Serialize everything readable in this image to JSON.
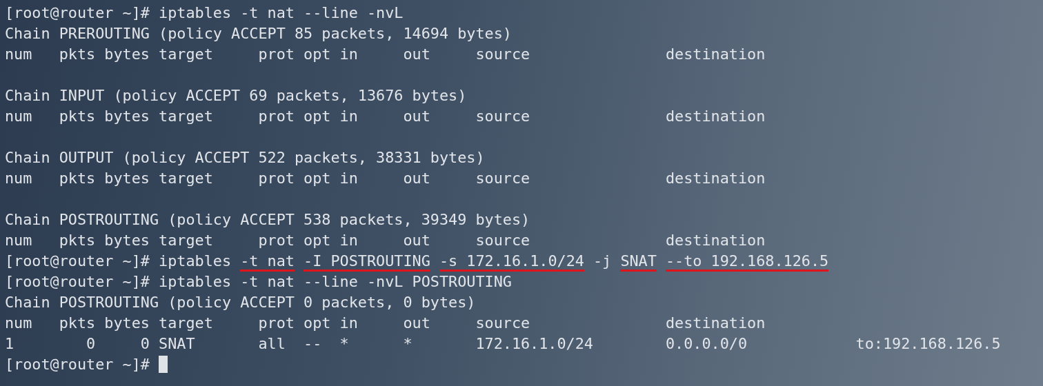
{
  "terminal": {
    "lines": [
      {
        "kind": "text",
        "segments": [
          {
            "text": "[root@router ~]# iptables -t nat --line -nvL",
            "underlined": false
          }
        ]
      },
      {
        "kind": "text",
        "segments": [
          {
            "text": "Chain PREROUTING (policy ACCEPT 85 packets, 14694 bytes)",
            "underlined": false
          }
        ]
      },
      {
        "kind": "text",
        "segments": [
          {
            "text": "num   pkts bytes target     prot opt in     out     source               destination",
            "underlined": false
          }
        ]
      },
      {
        "kind": "blank"
      },
      {
        "kind": "text",
        "segments": [
          {
            "text": "Chain INPUT (policy ACCEPT 69 packets, 13676 bytes)",
            "underlined": false
          }
        ]
      },
      {
        "kind": "text",
        "segments": [
          {
            "text": "num   pkts bytes target     prot opt in     out     source               destination",
            "underlined": false
          }
        ]
      },
      {
        "kind": "blank"
      },
      {
        "kind": "text",
        "segments": [
          {
            "text": "Chain OUTPUT (policy ACCEPT 522 packets, 38331 bytes)",
            "underlined": false
          }
        ]
      },
      {
        "kind": "text",
        "segments": [
          {
            "text": "num   pkts bytes target     prot opt in     out     source               destination",
            "underlined": false
          }
        ]
      },
      {
        "kind": "blank"
      },
      {
        "kind": "text",
        "segments": [
          {
            "text": "Chain POSTROUTING (policy ACCEPT 538 packets, 39349 bytes)",
            "underlined": false
          }
        ]
      },
      {
        "kind": "text",
        "segments": [
          {
            "text": "num   pkts bytes target     prot opt in     out     source               destination",
            "underlined": false
          }
        ]
      },
      {
        "kind": "text",
        "segments": [
          {
            "text": "[root@router ~]# iptables ",
            "underlined": false
          },
          {
            "text": "-t nat",
            "underlined": true
          },
          {
            "text": "-I POSTROUTING",
            "underlined": true
          },
          {
            "text": "-s 172.16.1.0/24",
            "underlined": true
          },
          {
            "text": " -j ",
            "underlined": false
          },
          {
            "text": "SNAT",
            "underlined": true
          },
          {
            "text": "--to 192.168.126.5",
            "underlined": true
          }
        ]
      },
      {
        "kind": "text",
        "segments": [
          {
            "text": "[root@router ~]# iptables -t nat --line -nvL POSTROUTING",
            "underlined": false
          }
        ]
      },
      {
        "kind": "text",
        "segments": [
          {
            "text": "Chain POSTROUTING (policy ACCEPT 0 packets, 0 bytes)",
            "underlined": false
          }
        ]
      },
      {
        "kind": "text",
        "segments": [
          {
            "text": "num   pkts bytes target     prot opt in     out     source               destination",
            "underlined": false
          }
        ]
      },
      {
        "kind": "text",
        "segments": [
          {
            "text": "1        0     0 SNAT       all  --  *      *       172.16.1.0/24        0.0.0.0/0            to:192.168.126.5",
            "underlined": false
          }
        ]
      },
      {
        "kind": "cursor",
        "segments": [
          {
            "text": "[root@router ~]# ",
            "underlined": false
          }
        ]
      }
    ]
  }
}
